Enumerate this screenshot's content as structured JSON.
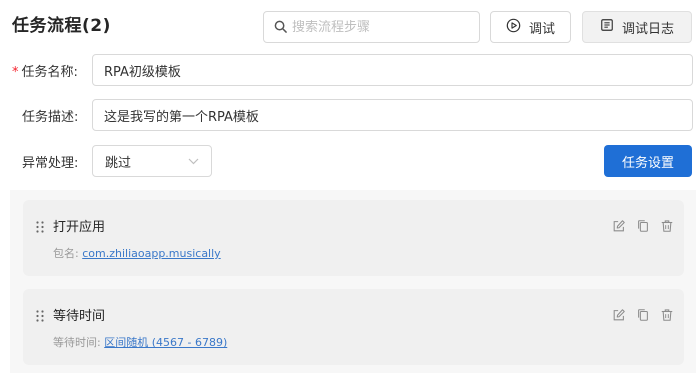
{
  "header": {
    "title": "任务流程",
    "count": "(2)",
    "search_placeholder": "搜索流程步骤",
    "debug_label": "调试",
    "log_label": "调试日志"
  },
  "form": {
    "name_required_mark": "*",
    "name_label": "任务名称:",
    "name_value": "RPA初级模板",
    "desc_label": "任务描述:",
    "desc_value": "这是我写的第一个RPA模板",
    "error_label": "异常处理:",
    "error_value": "跳过",
    "settings_label": "任务设置"
  },
  "steps": [
    {
      "name": "打开应用",
      "meta_label": "包名:",
      "meta_value": "com.zhiliaoapp.musically"
    },
    {
      "name": "等待时间",
      "meta_label": "等待时间:",
      "meta_value": "区间随机 (4567 - 6789)"
    }
  ],
  "icons": {
    "search": "search-icon",
    "debug": "play-circle-icon",
    "log": "log-icon",
    "select": "chevron-down-icon",
    "drag": "drag-handle-icon",
    "edit": "edit-icon",
    "copy": "copy-icon",
    "delete": "delete-icon"
  },
  "colors": {
    "primary": "#1f6fd6",
    "required": "#f5222d",
    "link": "#3a78c9"
  }
}
